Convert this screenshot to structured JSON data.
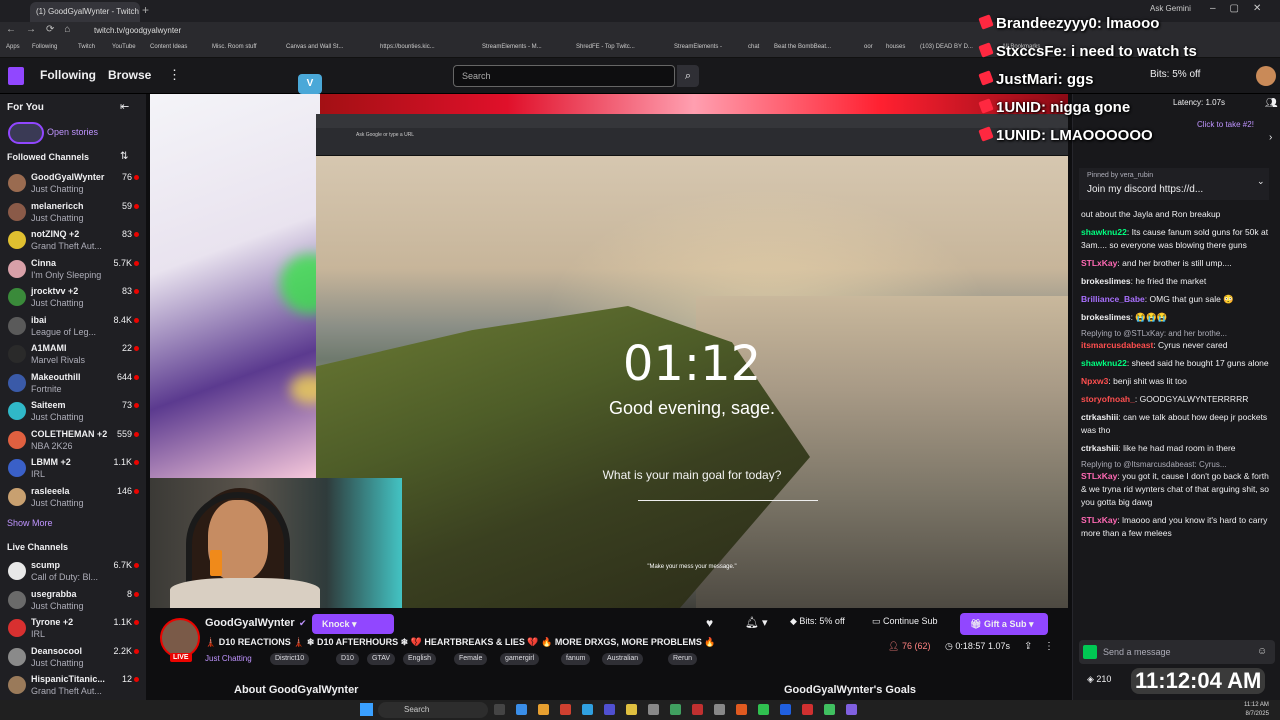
{
  "browser": {
    "tab_title": "(1) GoodGyalWynter - Twitch",
    "url": "twitch.tv/goodgyalwynter",
    "ask_gemini": "Ask Gemini",
    "bookmarks": [
      "Apps",
      "Following",
      "Twitch",
      "YouTube",
      "Content Ideas",
      "Misc. Room stuff",
      "Canvas and Wall St...",
      "https://bounties.kic...",
      "StreamElements - M...",
      "ShredFE - Top Twitc...",
      "StreamElements -",
      "chat",
      "Beat the BombBeat...",
      "oor",
      "houses",
      "(103) DEAD BY D...",
      "All Bookmarks"
    ]
  },
  "topnav": {
    "following": "Following",
    "browse": "Browse",
    "search_placeholder": "Search",
    "bits": "Bits: 5% off"
  },
  "sidebar": {
    "for_you": "For You",
    "open_stories": "Open stories",
    "followed_header": "Followed Channels",
    "followed": [
      {
        "name": "GoodGyalWynter",
        "game": "Just Chatting",
        "viewers": "76",
        "color": "#9a6b50"
      },
      {
        "name": "melanericch",
        "game": "Just Chatting",
        "viewers": "59",
        "color": "#8a5a48"
      },
      {
        "name": "notZINQ +2",
        "game": "Grand Theft Aut...",
        "viewers": "83",
        "color": "#e0c030"
      },
      {
        "name": "Cinna",
        "game": "I'm Only Sleeping",
        "viewers": "5.7K",
        "color": "#d8a0a8"
      },
      {
        "name": "jrocktvv +2",
        "game": "Just Chatting",
        "viewers": "83",
        "color": "#3a8a3a"
      },
      {
        "name": "ibai",
        "game": "League of Leg...",
        "viewers": "8.4K",
        "color": "#5a5a5a"
      },
      {
        "name": "A1MAMI",
        "game": "Marvel Rivals",
        "viewers": "22",
        "color": "#2a2a2a"
      },
      {
        "name": "Makeouthill",
        "game": "Fortnite",
        "viewers": "644",
        "color": "#3a5aa8"
      },
      {
        "name": "Saiteem",
        "game": "Just Chatting",
        "viewers": "73",
        "color": "#30b8c8"
      },
      {
        "name": "COLETHEMAN +2",
        "game": "NBA 2K26",
        "viewers": "559",
        "color": "#e06040"
      },
      {
        "name": "LBMM +2",
        "game": "IRL",
        "viewers": "1.1K",
        "color": "#3a60c8"
      },
      {
        "name": "rasleeela",
        "game": "Just Chatting",
        "viewers": "146",
        "color": "#c8a070"
      }
    ],
    "show_more": "Show More",
    "live_header": "Live Channels",
    "live": [
      {
        "name": "scump",
        "game": "Call of Duty: Bl...",
        "viewers": "6.7K",
        "color": "#e8e8e8"
      },
      {
        "name": "usegrabba",
        "game": "Just Chatting",
        "viewers": "8",
        "color": "#6a6a6a"
      },
      {
        "name": "Tyrone +2",
        "game": "IRL",
        "viewers": "1.1K",
        "color": "#d83030"
      },
      {
        "name": "Deansocool",
        "game": "Just Chatting",
        "viewers": "2.2K",
        "color": "#8a8a8a"
      },
      {
        "name": "HispanicTitanic...",
        "game": "Grand Theft Aut...",
        "viewers": "12",
        "color": "#9a7a5a"
      }
    ]
  },
  "video": {
    "clock": "01:12",
    "greeting": "Good evening, sage.",
    "goal_prompt": "What is your main goal for today?",
    "quote": "\"Make your mess your message.\"",
    "inner_url": "Ask Google or type a URL"
  },
  "stream": {
    "streamer": "GoodGyalWynter",
    "knock": "Knock",
    "title": "🗼 D10 REACTIONS 🗼 ❄ D10 AFTERHOURS ❄ 💔 HEARTBREAKS & LIES 💔 🔥 MORE DRXGS, MORE PROBLEMS 🔥",
    "category": "Just Chatting",
    "tags": [
      "District10",
      "D10",
      "GTAV",
      "English",
      "Female",
      "gamergirl",
      "fanum",
      "Australian",
      "Rerun"
    ],
    "live": "LIVE",
    "bits": "Bits: 5% off",
    "continue_sub": "Continue Sub",
    "gift_sub": "Gift a Sub",
    "viewers": "76 (62)",
    "uptime": "0:18:57",
    "rate": "1.07s",
    "about": "About GoodGyalWynter",
    "goals": "GoodGyalWynter's Goals"
  },
  "chat": {
    "latency": "Latency: 1.07s",
    "click_pred": "Click to take #2!",
    "pinned_by": "Pinned by vera_rubin",
    "pinned_msg": "Join my discord https://d...",
    "messages": [
      {
        "user": "",
        "text": "out about the Jayla and Ron breakup",
        "color": "#efeff1"
      },
      {
        "user": "shawknu22",
        "text": "Its cause fanum sold guns for 50k at 3am.... so everyone was blowing there guns",
        "color": "#00ff7f"
      },
      {
        "user": "STLxKay",
        "text": "and her brother is still ump....",
        "color": "#ff69b4"
      },
      {
        "user": "brokeslimes",
        "text": "he fried the market",
        "color": "#efeff1"
      },
      {
        "user": "Brilliance_Babe",
        "text": "OMG that gun sale 😳",
        "color": "#a970ff"
      },
      {
        "user": "brokeslimes",
        "text": "😭😭😭",
        "color": "#efeff1"
      },
      {
        "reply": "Replying to @STLxKay: and her brothe...",
        "user": "itsmarcusdabeast",
        "text": "Cyrus never cared",
        "color": "#ff4f4f"
      },
      {
        "user": "shawknu22",
        "text": "sheed said he bought 17 guns alone",
        "color": "#00ff7f"
      },
      {
        "user": "Npxw3",
        "text": "benji shit was lit too",
        "color": "#ff4f4f"
      },
      {
        "user": "storyofnoah_",
        "text": "GOODGYALWYNTERRRRR",
        "color": "#ff4f4f"
      },
      {
        "user": "ctrkashiii",
        "text": "can we talk about how deep jr pockets was tho",
        "color": "#efeff1"
      },
      {
        "user": "ctrkashiii",
        "text": "like he had mad room in there",
        "color": "#efeff1"
      },
      {
        "reply": "Replying to @Itsmarcusdabeast: Cyrus...",
        "user": "STLxKay",
        "text": "you got it, cause I don't go back & forth & we tryna rid wynters chat of that arguing shit, so you gotta big dawg",
        "color": "#ff69b4"
      },
      {
        "user": "STLxKay",
        "text": "lmaooo and you know it's hard to carry more than a few melees",
        "color": "#ff69b4"
      }
    ],
    "input_placeholder": "Send a message",
    "points": "210",
    "clock_overlay": "11:12:04 AM"
  },
  "overlay": [
    {
      "user": "Brandeezyyy0",
      "text": "lmaooo"
    },
    {
      "user": "StxccsFe",
      "text": "i need to watch ts"
    },
    {
      "user": "JustMari",
      "text": "ggs"
    },
    {
      "user": "1UNID",
      "text": "nigga gone"
    },
    {
      "user": "1UNID",
      "text": "LMAOOOOOO"
    }
  ],
  "os": {
    "search": "Search",
    "time": "11:12 AM",
    "date": "8/7/2025"
  }
}
